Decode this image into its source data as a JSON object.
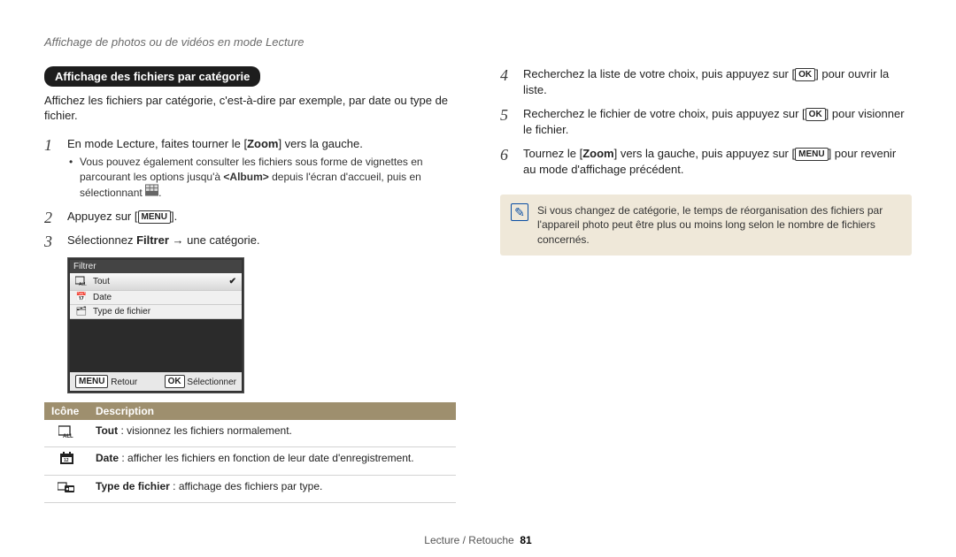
{
  "running_head": "Affichage de photos ou de vidéos en mode Lecture",
  "section_title": "Affichage des fichiers par catégorie",
  "intro": "Affichez les fichiers par catégorie, c'est-à-dire par exemple, par date ou type de fichier.",
  "keys": {
    "menu": "MENU",
    "ok": "OK"
  },
  "steps_left": {
    "s1_a": "En mode Lecture, faites tourner le [",
    "s1_zoom": "Zoom",
    "s1_b": "] vers la gauche.",
    "s1_sub_a": "Vous pouvez également consulter les fichiers sous forme de vignettes en parcourant les options jusqu'à ",
    "s1_sub_album": "<Album>",
    "s1_sub_b": " depuis l'écran d'accueil, puis en sélectionnant ",
    "s1_sub_icon_label": ".",
    "s2_a": "Appuyez sur [",
    "s2_b": "].",
    "s3_a": "Sélectionnez ",
    "s3_filter": "Filtrer",
    "s3_arrow": " → ",
    "s3_b": "une catégorie."
  },
  "screenshot": {
    "title": "Filtrer",
    "rows": [
      {
        "label": "Tout",
        "selected": true
      },
      {
        "label": "Date",
        "selected": false
      },
      {
        "label": "Type de fichier",
        "selected": false
      }
    ],
    "footer_left": "Retour",
    "footer_right": "Sélectionner"
  },
  "legend": {
    "head_icon": "Icône",
    "head_desc": "Description",
    "rows": [
      {
        "term": "Tout",
        "desc": " : visionnez les fichiers normalement."
      },
      {
        "term": "Date",
        "desc": " : afficher les fichiers en fonction de leur date d'enregistrement."
      },
      {
        "term": "Type de fichier",
        "desc": " : affichage des fichiers par type."
      }
    ]
  },
  "steps_right": {
    "s4_a": "Recherchez la liste de votre choix, puis appuyez sur [",
    "s4_b": "] pour ouvrir la liste.",
    "s5_a": "Recherchez le fichier de votre choix, puis appuyez sur [",
    "s5_b": "] pour visionner le fichier.",
    "s6_a": "Tournez le [",
    "s6_zoom": "Zoom",
    "s6_b": "] vers la gauche, puis appuyez sur [",
    "s6_c": "] pour revenir au mode d'affichage précédent."
  },
  "note": "Si vous changez de catégorie, le temps de réorganisation des fichiers par l'appareil photo peut être plus ou moins long selon le nombre de fichiers concernés.",
  "footer": {
    "section": "Lecture / Retouche",
    "page": "81"
  }
}
